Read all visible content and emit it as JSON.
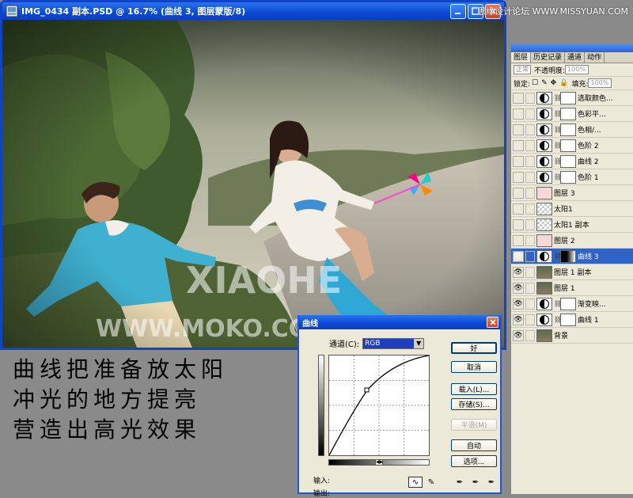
{
  "site_watermark": "思缘设计论坛 WWW.MISSYUAN.COM",
  "document": {
    "title": "IMG_0434 副本.PSD @ 16.7% (曲线 3, 图层蒙版/8)",
    "photo_watermark_1": "XIAOHE",
    "photo_watermark_2": "WWW.MOKO.CC/XUNUO"
  },
  "caption": {
    "line1": "曲线把准备放太阳",
    "line2": "冲光的地方提亮",
    "line3": "营造出高光效果"
  },
  "layers_panel": {
    "tabs": [
      "图层",
      "历史记录",
      "通道",
      "动作"
    ],
    "blend_mode": "正常",
    "opacity_label": "不透明度:",
    "opacity_value": "100%",
    "lock_label": "锁定:",
    "fill_label": "填充:",
    "fill_value": "100%",
    "layers": [
      {
        "name": "选取颜色...",
        "thumb": "adjust",
        "visible": false,
        "selected": false
      },
      {
        "name": "色彩平...",
        "thumb": "adjust",
        "visible": false,
        "selected": false
      },
      {
        "name": "色相/...",
        "thumb": "adjust",
        "visible": false,
        "selected": false
      },
      {
        "name": "色阶 2",
        "thumb": "adjust",
        "visible": false,
        "selected": false
      },
      {
        "name": "曲线 2",
        "thumb": "adjust",
        "visible": false,
        "selected": false
      },
      {
        "name": "色阶 1",
        "thumb": "adjust",
        "visible": false,
        "selected": false
      },
      {
        "name": "图层 3",
        "thumb": "pinkish",
        "visible": false,
        "selected": false
      },
      {
        "name": "太阳1",
        "thumb": "checker",
        "visible": false,
        "selected": false
      },
      {
        "name": "太阳1 副本",
        "thumb": "checker",
        "visible": false,
        "selected": false
      },
      {
        "name": "图层 2",
        "thumb": "pinkish",
        "visible": false,
        "selected": false
      },
      {
        "name": "曲线 3",
        "thumb": "adjust",
        "visible": true,
        "selected": true
      },
      {
        "name": "图层 1 副本",
        "thumb": "photo",
        "visible": true,
        "selected": false
      },
      {
        "name": "图层 1",
        "thumb": "photo",
        "visible": true,
        "selected": false
      },
      {
        "name": "渐变映...",
        "thumb": "adjust",
        "visible": true,
        "selected": false
      },
      {
        "name": "曲线 1",
        "thumb": "adjust",
        "visible": true,
        "selected": false
      },
      {
        "name": "背景",
        "thumb": "photo",
        "visible": true,
        "selected": false
      }
    ]
  },
  "curves_dialog": {
    "title": "曲线",
    "channel_label": "通道(C):",
    "channel_value": "RGB",
    "input_label": "输入:",
    "output_label": "输出:",
    "buttons": {
      "ok": "好",
      "cancel": "取消",
      "load": "载入(L)...",
      "save": "存储(S)...",
      "smooth": "平滑(M)",
      "auto": "自动",
      "options": "选项..."
    }
  }
}
